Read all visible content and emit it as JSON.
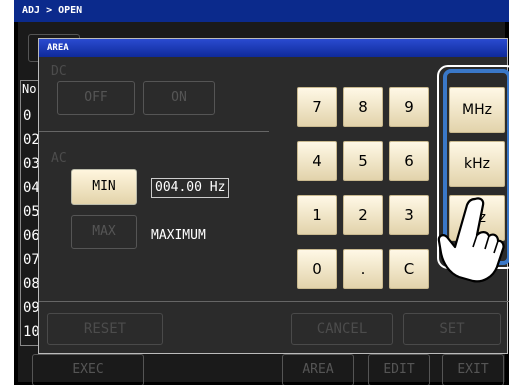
{
  "screen": {
    "breadcrumb": "ADJ > OPEN",
    "bg_labels": {
      "no_header": "No",
      "bg_button_top": "",
      "rows": [
        "0",
        "02",
        "03",
        "04",
        "05",
        "06",
        "07",
        "08",
        "09",
        "10"
      ]
    },
    "bottom": {
      "exec": "EXEC",
      "area": "AREA",
      "edit": "EDIT",
      "exit": "EXIT"
    }
  },
  "dialog": {
    "title": "AREA",
    "dc_label": "DC",
    "off_label": "OFF",
    "on_label": "ON",
    "ac_label": "AC",
    "min_label": "MIN",
    "min_value": "004.00 Hz",
    "max_label": "MAX",
    "max_value": "MAXIMUM",
    "keypad": [
      "7",
      "8",
      "9",
      "4",
      "5",
      "6",
      "1",
      "2",
      "3",
      "0",
      ".",
      "C"
    ],
    "units": [
      "MHz",
      "kHz",
      "Hz"
    ],
    "reset_label": "RESET",
    "cancel_label": "CANCEL",
    "set_label": "SET"
  },
  "colors": {
    "titlebar": "#0b2a8c",
    "dialog_title": "#1f3bb8",
    "key_fill": "#f4e8c6",
    "highlight": "#3a78c8"
  }
}
